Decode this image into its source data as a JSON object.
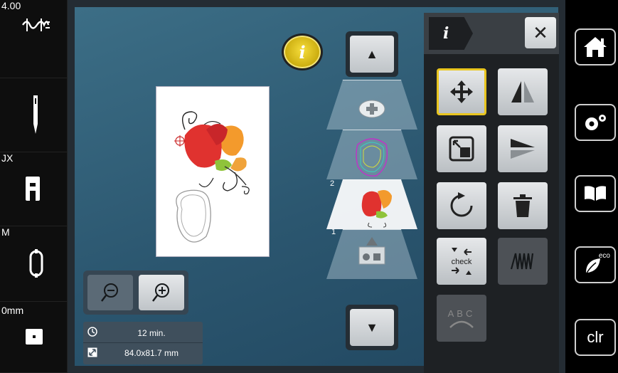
{
  "left_status": {
    "upper_thread_tension": "4.00",
    "needle_label": "",
    "presser_foot": "JX",
    "hoop": "M",
    "stitch_width": "0mm"
  },
  "info_card": {
    "time": "12 min.",
    "size": "84.0x81.7 mm"
  },
  "panel": {
    "tab_label": "i",
    "close_label": "✕"
  },
  "info_button_label": "i",
  "right_buttons": {
    "eco_label": "eco",
    "clr_label": "clr"
  },
  "tools": {
    "check_label": "check",
    "abc_label": "ABC"
  },
  "layers": {
    "layer_2_number": "2",
    "layer_1_number": "1"
  },
  "colors": {
    "accent_yellow": "#e8c51f",
    "screen_blue": "#2b566f"
  }
}
